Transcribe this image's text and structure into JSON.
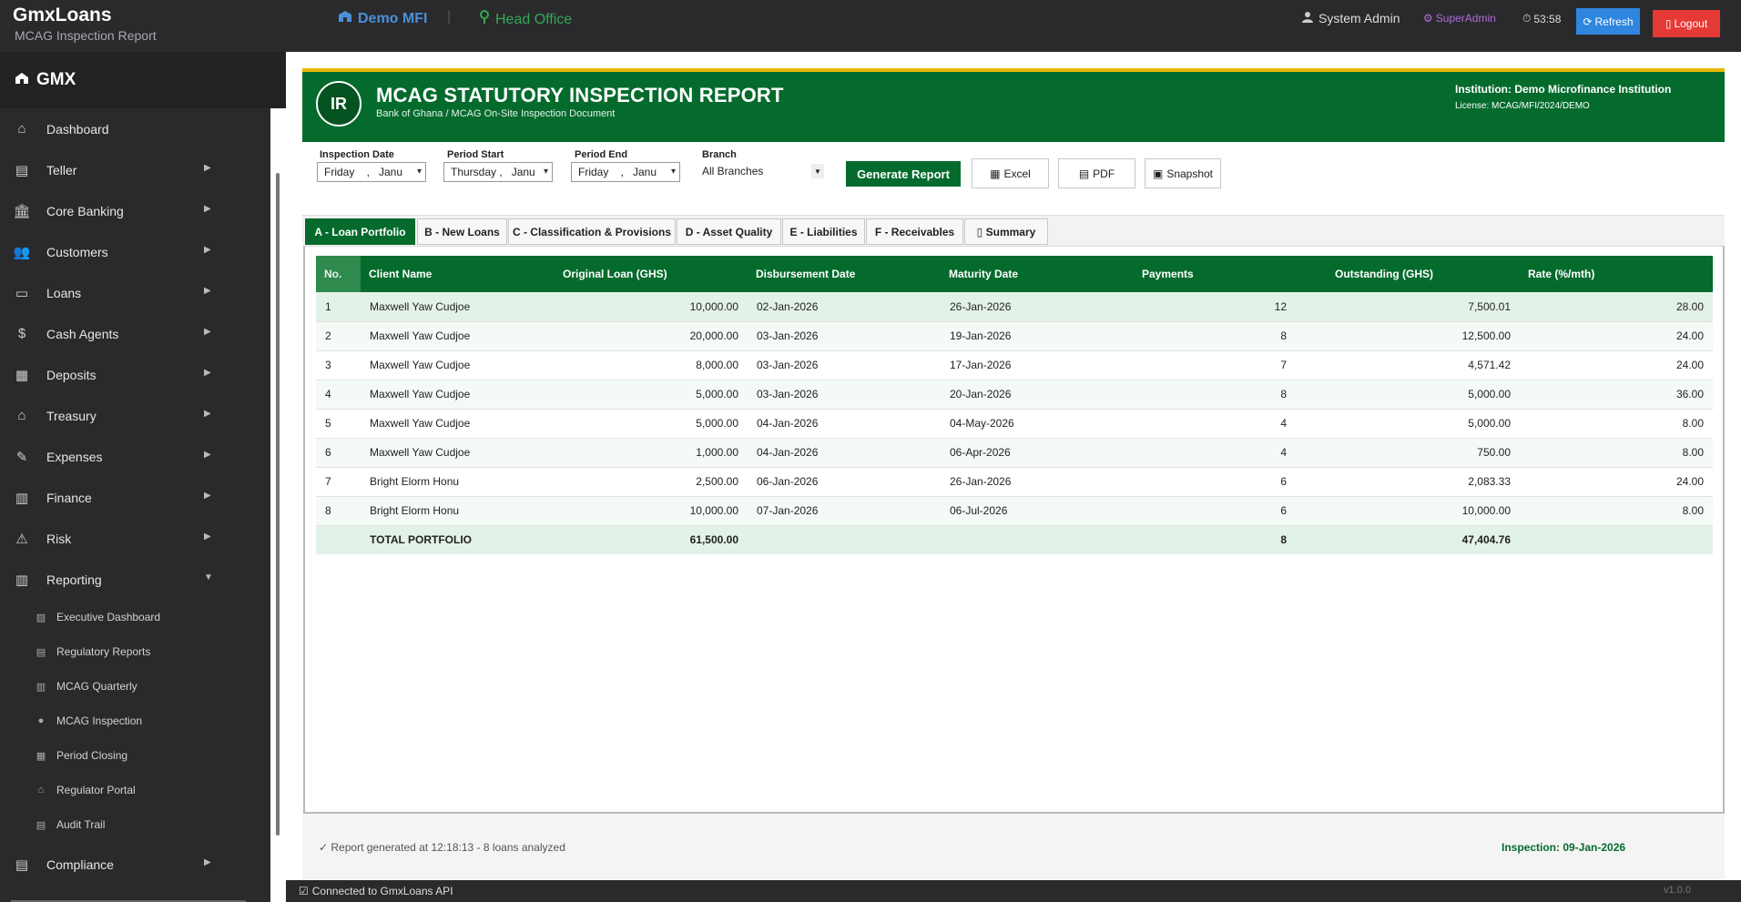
{
  "app": {
    "title": "GmxLoans",
    "subtitle": "MCAG Inspection Report",
    "org_name": "Demo MFI",
    "branch_name": "Head Office",
    "user_name": "System Admin",
    "role": "SuperAdmin",
    "timer": "53:58",
    "refresh_label": "Refresh",
    "logout_label": "Logout"
  },
  "sidebar": {
    "brand": "GMX",
    "items": [
      {
        "label": "Dashboard",
        "icon": "dashboard-icon",
        "glyph": "⌂",
        "has_arrow": false
      },
      {
        "label": "Teller",
        "icon": "teller-icon",
        "glyph": "▤",
        "has_arrow": true
      },
      {
        "label": "Core Banking",
        "icon": "bank-icon",
        "glyph": "🏛",
        "has_arrow": true
      },
      {
        "label": "Customers",
        "icon": "customers-icon",
        "glyph": "👥",
        "has_arrow": true
      },
      {
        "label": "Loans",
        "icon": "loans-icon",
        "glyph": "▭",
        "has_arrow": true
      },
      {
        "label": "Cash Agents",
        "icon": "cash-agents-icon",
        "glyph": "$",
        "has_arrow": true
      },
      {
        "label": "Deposits",
        "icon": "deposits-icon",
        "glyph": "▦",
        "has_arrow": true
      },
      {
        "label": "Treasury",
        "icon": "treasury-icon",
        "glyph": "⌂",
        "has_arrow": true
      },
      {
        "label": "Expenses",
        "icon": "expenses-icon",
        "glyph": "✎",
        "has_arrow": true
      },
      {
        "label": "Finance",
        "icon": "finance-icon",
        "glyph": "▥",
        "has_arrow": true
      },
      {
        "label": "Risk",
        "icon": "risk-icon",
        "glyph": "⚠",
        "has_arrow": true
      },
      {
        "label": "Reporting",
        "icon": "reporting-icon",
        "glyph": "▥",
        "has_arrow": true,
        "expanded": true
      }
    ],
    "sub_items": [
      {
        "label": "Executive Dashboard",
        "icon": "executive-dashboard-icon",
        "glyph": "▨"
      },
      {
        "label": "Regulatory Reports",
        "icon": "regulatory-reports-icon",
        "glyph": "▤"
      },
      {
        "label": "MCAG Quarterly",
        "icon": "mcag-quarterly-icon",
        "glyph": "▥"
      },
      {
        "label": "MCAG Inspection",
        "icon": "mcag-inspection-icon",
        "glyph": "●"
      },
      {
        "label": "Period Closing",
        "icon": "period-closing-icon",
        "glyph": "▦"
      },
      {
        "label": "Regulator Portal",
        "icon": "regulator-portal-icon",
        "glyph": "⌂"
      },
      {
        "label": "Audit Trail",
        "icon": "audit-trail-icon",
        "glyph": "▤"
      }
    ],
    "compliance": {
      "label": "Compliance",
      "icon": "compliance-icon",
      "glyph": "▤"
    }
  },
  "report": {
    "badge": "IR",
    "title": "MCAG STATUTORY INSPECTION REPORT",
    "subtitle": "Bank of Ghana / MCAG On-Site Inspection Document",
    "institution": "Institution: Demo Microfinance Institution",
    "license": "License: MCAG/MFI/2024/DEMO"
  },
  "filters": {
    "inspection_date_label": "Inspection Date",
    "inspection_date_value": "Friday    ,   Janu",
    "period_start_label": "Period Start",
    "period_start_value": "Thursday ,   Janu",
    "period_end_label": "Period End",
    "period_end_value": "Friday    ,   Janu",
    "branch_label": "Branch",
    "branch_value": "All Branches",
    "generate_label": "Generate Report",
    "excel_label": "Excel",
    "pdf_label": "PDF",
    "snapshot_label": "Snapshot"
  },
  "tabs": [
    "A - Loan Portfolio",
    "B - New Loans",
    "C - Classification & Provisions",
    "D - Asset Quality",
    "E - Liabilities",
    "F - Receivables",
    "▯ Summary"
  ],
  "table": {
    "headers": [
      "No.",
      "Client Name",
      "Original Loan (GHS)",
      "Disbursement Date",
      "Maturity Date",
      "Payments",
      "Outstanding (GHS)",
      "Rate (%/mth)"
    ],
    "rows": [
      [
        "1",
        "Maxwell Yaw Cudjoe",
        "10,000.00",
        "02-Jan-2026",
        "26-Jan-2026",
        "12",
        "7,500.01",
        "28.00"
      ],
      [
        "2",
        "Maxwell Yaw Cudjoe",
        "20,000.00",
        "03-Jan-2026",
        "19-Jan-2026",
        "8",
        "12,500.00",
        "24.00"
      ],
      [
        "3",
        "Maxwell Yaw Cudjoe",
        "8,000.00",
        "03-Jan-2026",
        "17-Jan-2026",
        "7",
        "4,571.42",
        "24.00"
      ],
      [
        "4",
        "Maxwell Yaw Cudjoe",
        "5,000.00",
        "03-Jan-2026",
        "20-Jan-2026",
        "8",
        "5,000.00",
        "36.00"
      ],
      [
        "5",
        "Maxwell Yaw Cudjoe",
        "5,000.00",
        "04-Jan-2026",
        "04-May-2026",
        "4",
        "5,000.00",
        "8.00"
      ],
      [
        "6",
        "Maxwell Yaw Cudjoe",
        "1,000.00",
        "04-Jan-2026",
        "06-Apr-2026",
        "4",
        "750.00",
        "8.00"
      ],
      [
        "7",
        "Bright Elorm Honu",
        "2,500.00",
        "06-Jan-2026",
        "26-Jan-2026",
        "6",
        "2,083.33",
        "24.00"
      ],
      [
        "8",
        "Bright Elorm Honu",
        "10,000.00",
        "07-Jan-2026",
        "06-Jul-2026",
        "6",
        "10,000.00",
        "8.00"
      ]
    ],
    "total": [
      "",
      "TOTAL PORTFOLIO",
      "61,500.00",
      "",
      "",
      "8",
      "47,404.76",
      ""
    ]
  },
  "footer": {
    "status": "✓ Report generated at 12:18:13 - 8 loans analyzed",
    "inspection": "Inspection: 09-Jan-2026"
  },
  "statusbar": {
    "connection": "Connected to GmxLoans API",
    "version": "v1.0.0"
  },
  "colors": {
    "primary_green": "#056b2d",
    "accent_gold": "#e6b800",
    "sidebar_bg": "#2a2a2d",
    "refresh_blue": "#2e86de",
    "logout_red": "#e53935"
  }
}
